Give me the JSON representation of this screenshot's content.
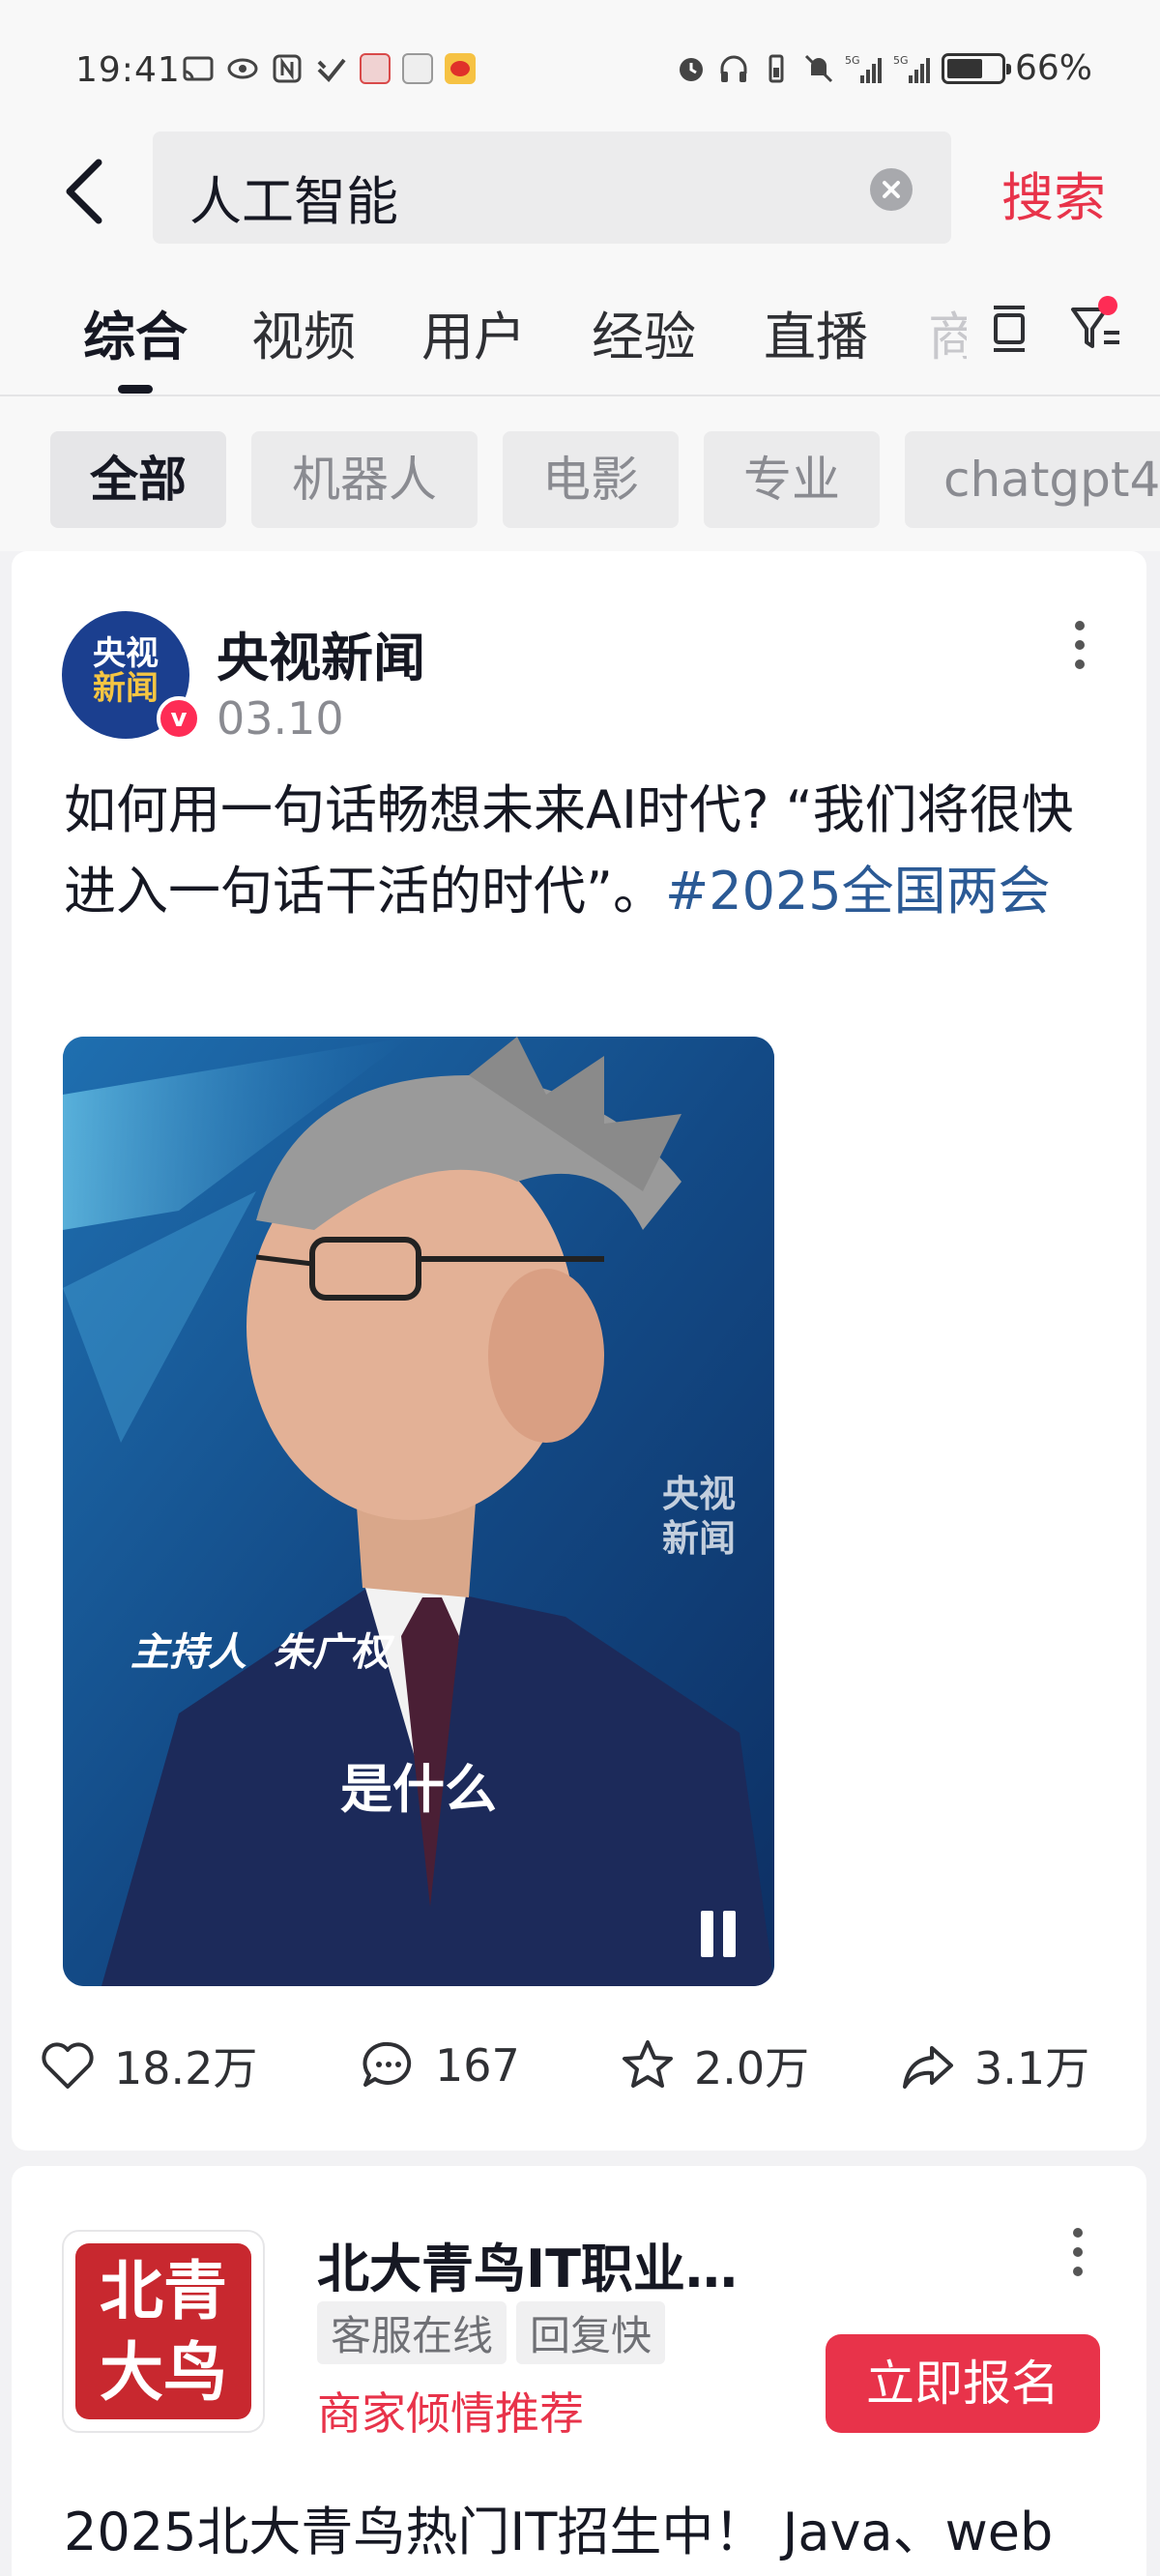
{
  "status_bar": {
    "time": "19:41",
    "battery_pct": "66%",
    "battery_level": 0.66,
    "left_icons": [
      "cast-icon",
      "eye-icon",
      "nfc-icon",
      "vpn-icon",
      "app-notification-icon",
      "app-notification-icon",
      "weibo-icon"
    ],
    "right_icons": [
      "alarm-icon",
      "headphones-icon",
      "vibrate-icon",
      "mute-icon",
      "signal-5g-icon",
      "signal-5g-icon",
      "battery-icon"
    ]
  },
  "search": {
    "query": "人工智能",
    "submit_label": "搜索"
  },
  "tabs": {
    "items": [
      "综合",
      "视频",
      "用户",
      "经验",
      "直播"
    ],
    "active_index": 0,
    "overflow_fragment": "商"
  },
  "filters": {
    "items": [
      "全部",
      "机器人",
      "电影",
      "专业",
      "chatgpt4"
    ],
    "active_index": 0
  },
  "post": {
    "author": {
      "name": "央视新闻",
      "avatar_text_1": "央视",
      "avatar_text_2": "新闻",
      "verified_mark": "v"
    },
    "date": "03.10",
    "text": "如何用一句话畅想未来AI时代? “我们将很快进入一句话干活的时代”。",
    "hashtag": "#2025全国两会",
    "video": {
      "watermark_1": "央视",
      "watermark_2": "新闻",
      "host_caption": "主持人  朱广权",
      "subtitle": "是什么"
    },
    "stats": {
      "likes": "18.2万",
      "comments": "167",
      "favorites": "2.0万",
      "shares": "3.1万"
    }
  },
  "ad": {
    "logo_text_1": "北青",
    "logo_text_2": "大鸟",
    "name": "北大青鸟IT职业…",
    "tags": [
      "客服在线",
      "回复快"
    ],
    "recommend": "商家倾情推荐",
    "cta": "立即报名",
    "description": "2025北大青鸟热门IT招生中！ Java、web"
  },
  "colors": {
    "accent": "#e8334a",
    "hashtag": "#2b5a95",
    "text_primary": "#161823",
    "text_secondary": "#8a8b91",
    "video_bg": "#1a4a8c"
  }
}
